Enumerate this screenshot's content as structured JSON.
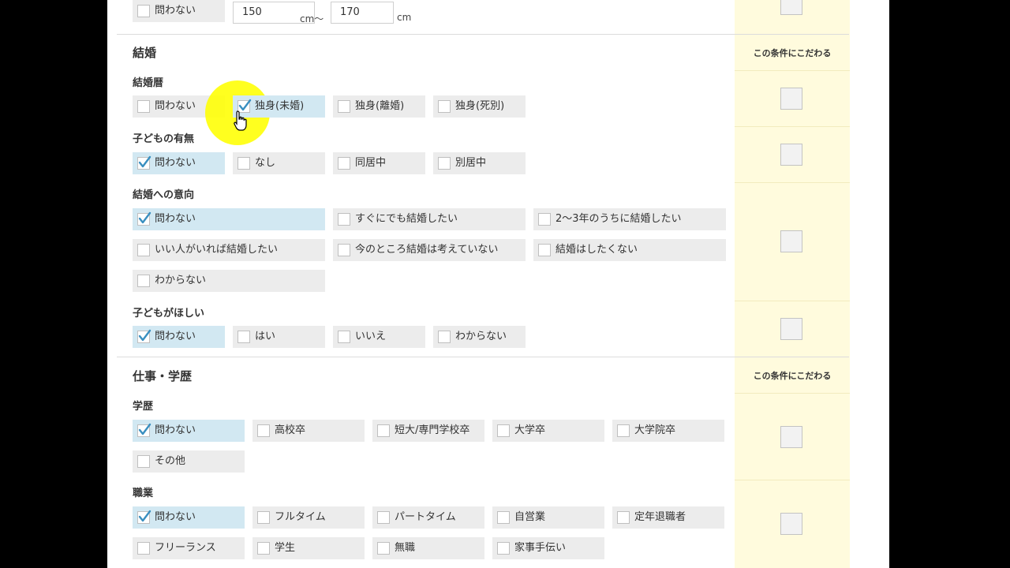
{
  "height": {
    "any_label": "問わない",
    "min_value": "150",
    "unit_mid": "cm～",
    "max_value": "170",
    "unit_end": "cm"
  },
  "marriage": {
    "title": "結婚",
    "prefer_header": "この条件にこだわる",
    "history": {
      "label": "結婚暦",
      "options": [
        {
          "label": "問わない",
          "checked": false
        },
        {
          "label": "独身(未婚)",
          "checked": true
        },
        {
          "label": "独身(離婚)",
          "checked": false
        },
        {
          "label": "独身(死別)",
          "checked": false
        }
      ]
    },
    "children": {
      "label": "子どもの有無",
      "options": [
        {
          "label": "問わない",
          "checked": true
        },
        {
          "label": "なし",
          "checked": false
        },
        {
          "label": "同居中",
          "checked": false
        },
        {
          "label": "別居中",
          "checked": false
        }
      ]
    },
    "intention": {
      "label": "結婚への意向",
      "options": [
        {
          "label": "問わない",
          "checked": true
        },
        {
          "label": "すぐにでも結婚したい",
          "checked": false
        },
        {
          "label": "2～3年のうちに結婚したい",
          "checked": false
        },
        {
          "label": "いい人がいれば結婚したい",
          "checked": false
        },
        {
          "label": "今のところ結婚は考えていない",
          "checked": false
        },
        {
          "label": "結婚はしたくない",
          "checked": false
        },
        {
          "label": "わからない",
          "checked": false
        }
      ]
    },
    "want_children": {
      "label": "子どもがほしい",
      "options": [
        {
          "label": "問わない",
          "checked": true
        },
        {
          "label": "はい",
          "checked": false
        },
        {
          "label": "いいえ",
          "checked": false
        },
        {
          "label": "わからない",
          "checked": false
        }
      ]
    }
  },
  "work": {
    "title": "仕事・学歴",
    "prefer_header": "この条件にこだわる",
    "education": {
      "label": "学歴",
      "options": [
        {
          "label": "問わない",
          "checked": true
        },
        {
          "label": "高校卒",
          "checked": false
        },
        {
          "label": "短大/専門学校卒",
          "checked": false
        },
        {
          "label": "大学卒",
          "checked": false
        },
        {
          "label": "大学院卒",
          "checked": false
        },
        {
          "label": "その他",
          "checked": false
        }
      ]
    },
    "occupation": {
      "label": "職業",
      "options": [
        {
          "label": "問わない",
          "checked": true
        },
        {
          "label": "フルタイム",
          "checked": false
        },
        {
          "label": "パートタイム",
          "checked": false
        },
        {
          "label": "自営業",
          "checked": false
        },
        {
          "label": "定年退職者",
          "checked": false
        },
        {
          "label": "フリーランス",
          "checked": false
        },
        {
          "label": "学生",
          "checked": false
        },
        {
          "label": "無職",
          "checked": false
        },
        {
          "label": "家事手伝い",
          "checked": false
        }
      ]
    }
  },
  "colors": {
    "selected_bg": "#d2e8f2",
    "option_bg": "#ececec",
    "prefer_column_bg": "#fffbdd",
    "check_color": "#3a8fc0",
    "cursor_highlight": "#ffff00"
  }
}
